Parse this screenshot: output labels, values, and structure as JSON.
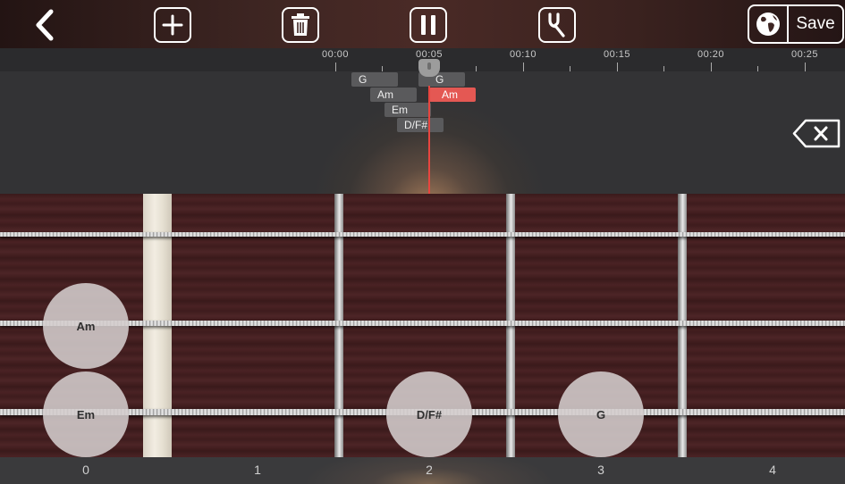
{
  "toolbar": {
    "buttons": [
      "back-icon",
      "plus-icon",
      "trash-icon",
      "pause-icon",
      "tuning-fork-icon",
      "globe-icon"
    ],
    "save_label": "Save"
  },
  "timeline": {
    "labels": [
      "00:00",
      "00:05",
      "00:10",
      "00:15",
      "00:20",
      "00:25"
    ]
  },
  "chords_track": {
    "chips": [
      {
        "label": "G",
        "active": false
      },
      {
        "label": "G",
        "active": false
      },
      {
        "label": "Am",
        "active": false
      },
      {
        "label": "Am",
        "active": true
      },
      {
        "label": "Em",
        "active": false
      },
      {
        "label": "D/F#",
        "active": false
      }
    ],
    "active_color": "#e45853",
    "playhead_color": "#e8453f"
  },
  "fretboard": {
    "markers": [
      {
        "label": "Am"
      },
      {
        "label": "Em"
      },
      {
        "label": "D/F#"
      },
      {
        "label": "G"
      }
    ],
    "fret_numbers": [
      "0",
      "1",
      "2",
      "3",
      "4"
    ]
  }
}
